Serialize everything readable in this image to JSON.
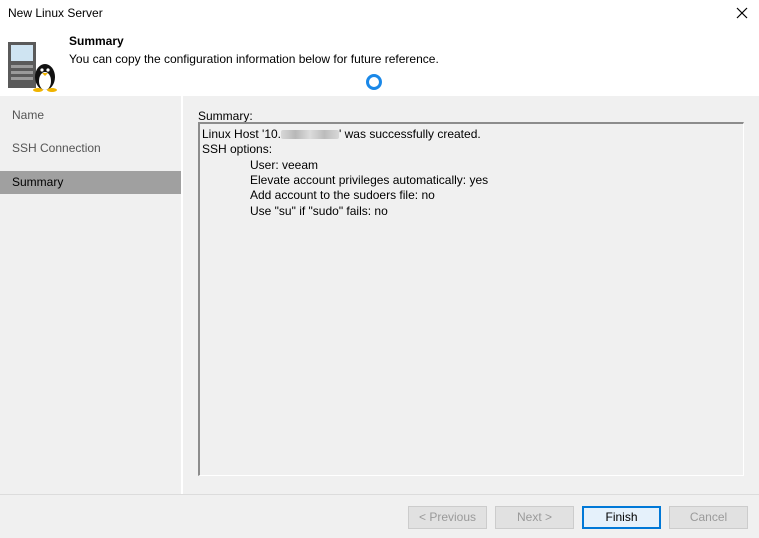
{
  "window": {
    "title": "New Linux Server"
  },
  "header": {
    "title": "Summary",
    "subtitle": "You can copy the configuration information below for future reference."
  },
  "sidebar": {
    "items": [
      {
        "label": "Name",
        "active": false
      },
      {
        "label": "SSH Connection",
        "active": false
      },
      {
        "label": "Summary",
        "active": true
      }
    ]
  },
  "main": {
    "summary_label": "Summary:",
    "summary_lines": {
      "host_prefix": "Linux Host '10.",
      "host_suffix": "' was successfully created.",
      "ssh_options": "SSH options:",
      "user": "User: veeam",
      "elevate": "Elevate account privileges automatically: yes",
      "sudoers": "Add account to the sudoers file: no",
      "su": "Use \"su\" if \"sudo\" fails: no"
    }
  },
  "footer": {
    "previous": "< Previous",
    "next": "Next >",
    "finish": "Finish",
    "cancel": "Cancel"
  },
  "icons": {
    "close": "close-icon",
    "header": "linux-server-icon",
    "busy": "busy-ring-icon"
  },
  "colors": {
    "accent": "#0078d7",
    "selected_nav": "#a0a0a0",
    "panel_bg": "#f0f0f0",
    "busy_ring": "#1a88e8"
  }
}
